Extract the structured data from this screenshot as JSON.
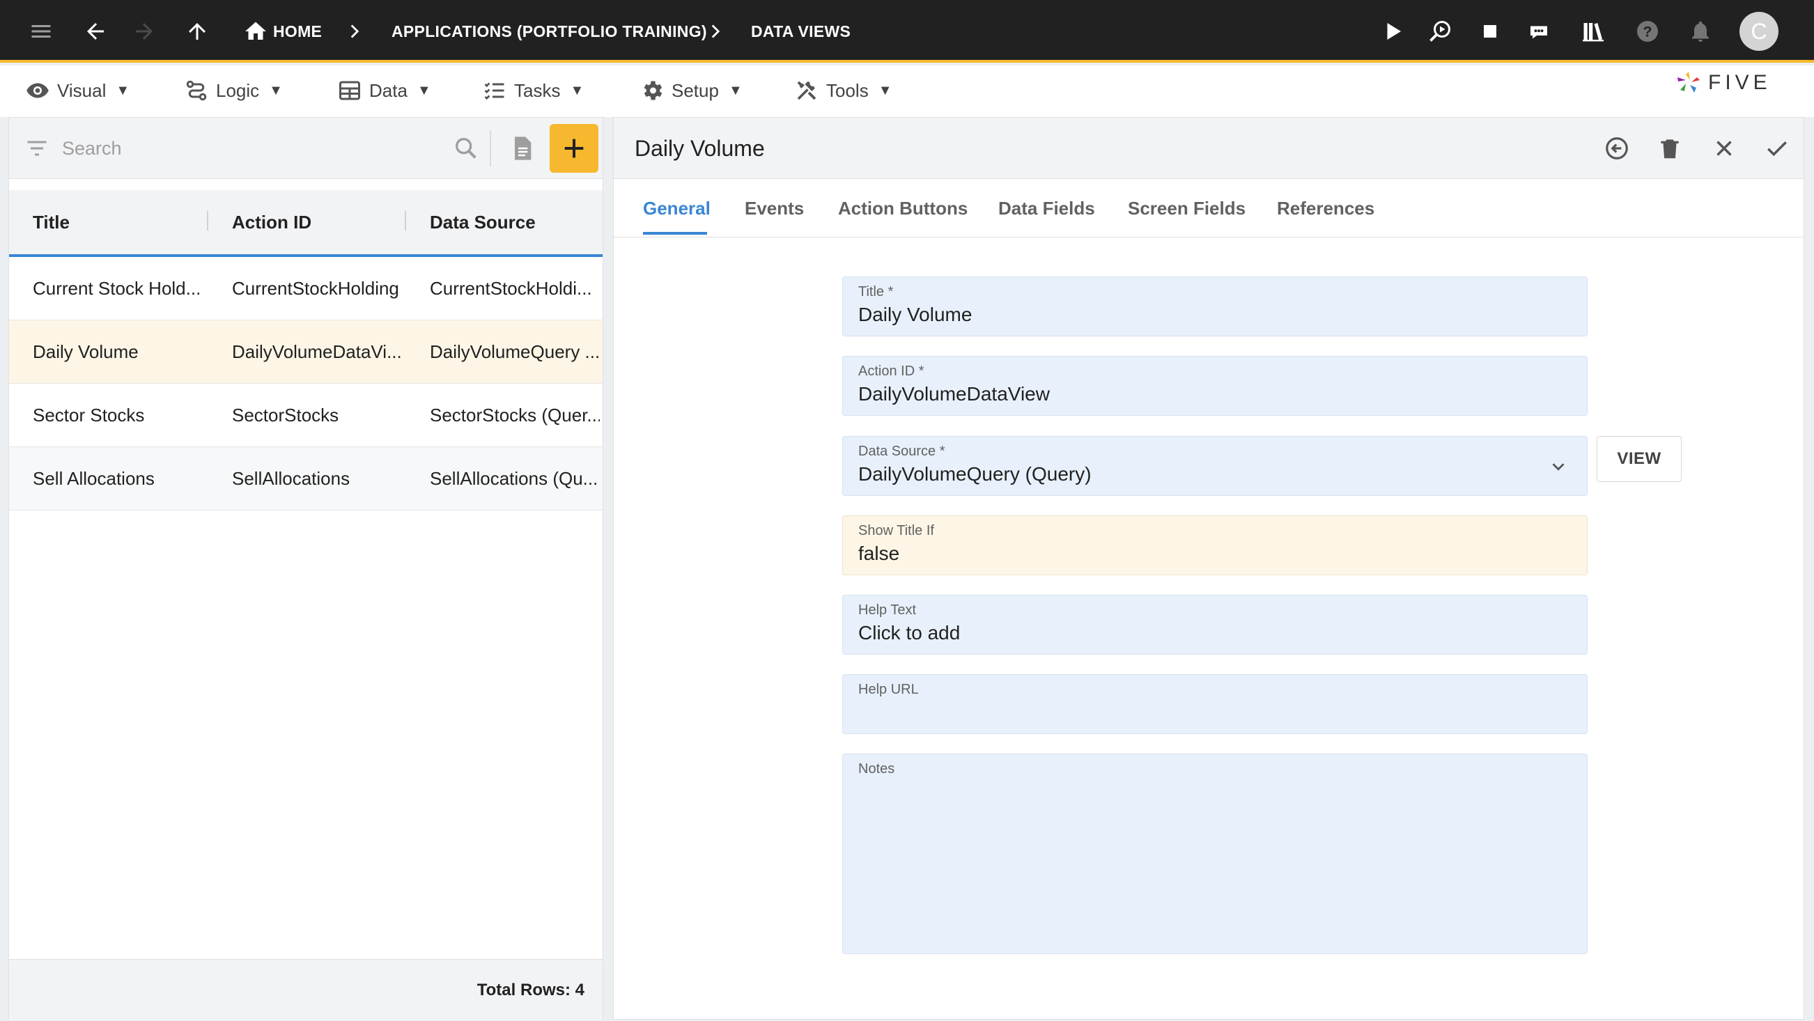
{
  "topbar": {
    "breadcrumbs": [
      "HOME",
      "APPLICATIONS (PORTFOLIO TRAINING)",
      "DATA VIEWS"
    ],
    "avatar_initial": "C",
    "icons": [
      "menu-icon",
      "back-icon",
      "forward-icon",
      "up-icon",
      "home-icon",
      "play-icon",
      "inspect-icon",
      "stop-icon",
      "chat-icon",
      "library-icon",
      "help-icon",
      "bell-icon"
    ]
  },
  "menubar": {
    "items": [
      {
        "label": "Visual",
        "icon": "eye-icon"
      },
      {
        "label": "Logic",
        "icon": "logic-icon"
      },
      {
        "label": "Data",
        "icon": "table-icon"
      },
      {
        "label": "Tasks",
        "icon": "tasks-icon"
      },
      {
        "label": "Setup",
        "icon": "gear-icon"
      },
      {
        "label": "Tools",
        "icon": "tools-icon"
      }
    ],
    "caret": "▼",
    "logo_text": "FIVE"
  },
  "list": {
    "search_placeholder": "Search",
    "columns": [
      "Title",
      "Action ID",
      "Data Source"
    ],
    "rows": [
      {
        "title": "Current Stock Hold...",
        "action_id": "CurrentStockHolding",
        "data_source": "CurrentStockHoldi..."
      },
      {
        "title": "Daily Volume",
        "action_id": "DailyVolumeDataVi...",
        "data_source": "DailyVolumeQuery ..."
      },
      {
        "title": "Sector Stocks",
        "action_id": "SectorStocks",
        "data_source": "SectorStocks (Quer..."
      },
      {
        "title": "Sell Allocations",
        "action_id": "SellAllocations",
        "data_source": "SellAllocations (Qu..."
      }
    ],
    "selected_index": 1,
    "total_rows": "Total Rows: 4"
  },
  "form": {
    "title": "Daily Volume",
    "tabs": [
      "General",
      "Events",
      "Action Buttons",
      "Data Fields",
      "Screen Fields",
      "References"
    ],
    "active_tab": 0,
    "fields": {
      "title": {
        "label": "Title *",
        "value": "Daily Volume"
      },
      "action_id": {
        "label": "Action ID *",
        "value": "DailyVolumeDataView"
      },
      "data_source": {
        "label": "Data Source *",
        "value": "DailyVolumeQuery (Query)"
      },
      "show_title_if": {
        "label": "Show Title If",
        "value": "false"
      },
      "help_text": {
        "label": "Help Text",
        "value": "Click to add"
      },
      "help_url": {
        "label": "Help URL",
        "value": ""
      },
      "notes": {
        "label": "Notes",
        "value": ""
      }
    },
    "view_button": "VIEW"
  },
  "colors": {
    "topbar_bg": "#212121",
    "accent_yellow": "#f5b82e",
    "accent_blue": "#3a86d4",
    "field_bg": "#e8f1fb",
    "selected_row": "#fdf6e6"
  }
}
